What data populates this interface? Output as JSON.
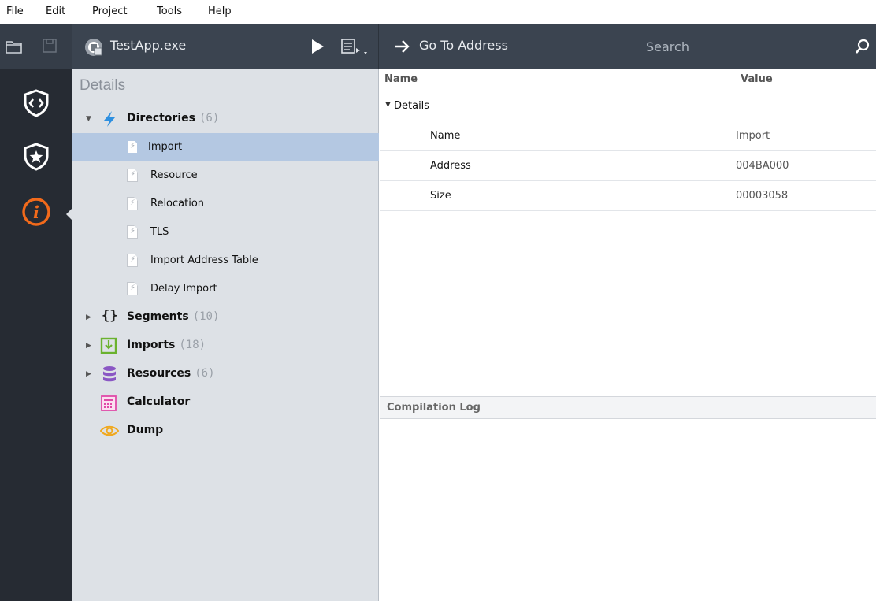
{
  "menu": [
    "File",
    "Edit",
    "Project",
    "Tools",
    "Help"
  ],
  "toolbar": {
    "project_name": "TestApp.exe",
    "goto_label": "Go To Address",
    "search_placeholder": "Search"
  },
  "rail": {
    "items": [
      "shield-code-icon",
      "shield-star-icon",
      "info-icon"
    ],
    "active": "info-icon"
  },
  "tree": {
    "title": "Details",
    "directories": {
      "label": "Directories",
      "count": "(6)",
      "children": [
        "Import",
        "Resource",
        "Relocation",
        "TLS",
        "Import Address Table",
        "Delay Import"
      ],
      "selected": "Import"
    },
    "segments": {
      "label": "Segments",
      "count": "(10)"
    },
    "imports": {
      "label": "Imports",
      "count": "(18)"
    },
    "resources": {
      "label": "Resources",
      "count": "(6)"
    },
    "calculator": {
      "label": "Calculator"
    },
    "dump": {
      "label": "Dump"
    }
  },
  "grid": {
    "col_name": "Name",
    "col_value": "Value",
    "group": "Details",
    "rows": [
      {
        "name": "Name",
        "value": "Import"
      },
      {
        "name": "Address",
        "value": "004BA000"
      },
      {
        "name": "Size",
        "value": "00003058"
      }
    ]
  },
  "log": {
    "title": "Compilation Log"
  },
  "colors": {
    "accent_blue": "#2d8fe0",
    "info_orange": "#f26a1b",
    "selection": "#b4c8e2"
  }
}
